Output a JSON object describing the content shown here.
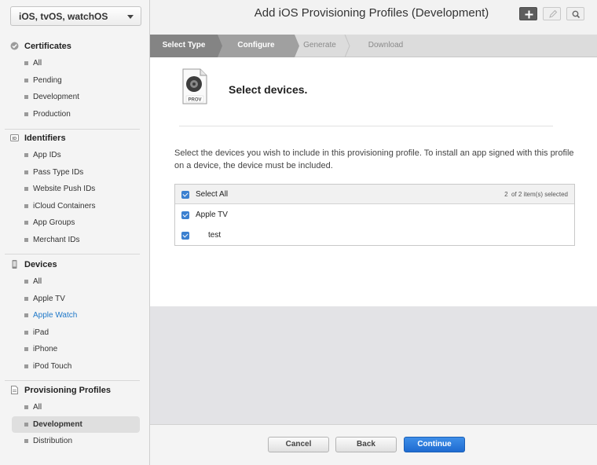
{
  "sidebar": {
    "platform": "iOS, tvOS, watchOS",
    "sections": {
      "certificates": {
        "title": "Certificates",
        "items": [
          "All",
          "Pending",
          "Development",
          "Production"
        ]
      },
      "identifiers": {
        "title": "Identifiers",
        "items": [
          "App IDs",
          "Pass Type IDs",
          "Website Push IDs",
          "iCloud Containers",
          "App Groups",
          "Merchant IDs"
        ]
      },
      "devices": {
        "title": "Devices",
        "items": [
          "All",
          "Apple TV",
          "Apple Watch",
          "iPad",
          "iPhone",
          "iPod Touch"
        ]
      },
      "profiles": {
        "title": "Provisioning Profiles",
        "items": [
          "All",
          "Development",
          "Distribution"
        ]
      }
    },
    "selected": "Development",
    "link_item": "Apple Watch",
    "icons": {
      "certificates": "certificate-icon",
      "identifiers": "id-badge-icon",
      "devices": "phone-icon",
      "profiles": "profile-icon"
    }
  },
  "header": {
    "title": "Add iOS Provisioning Profiles (Development)",
    "buttons": [
      "add-icon",
      "edit-icon",
      "search-icon"
    ]
  },
  "steps": [
    "Select Type",
    "Configure",
    "Generate",
    "Download"
  ],
  "content": {
    "icon_label": "PROV",
    "title": "Select devices.",
    "description": "Select the devices you wish to include in this provisioning profile. To install an app signed with this profile on a device, the device must be included.",
    "select_all": "Select All",
    "count_text": "2  of 2 item(s) selected",
    "rows": [
      {
        "label": "Apple TV",
        "checked": true
      },
      {
        "label": "test",
        "checked": true
      }
    ]
  },
  "footer": {
    "cancel": "Cancel",
    "back": "Back",
    "continue": "Continue"
  },
  "colors": {
    "accent": "#3b80d0",
    "link": "#1f78c8",
    "primary_button": "#2a7ae0"
  }
}
